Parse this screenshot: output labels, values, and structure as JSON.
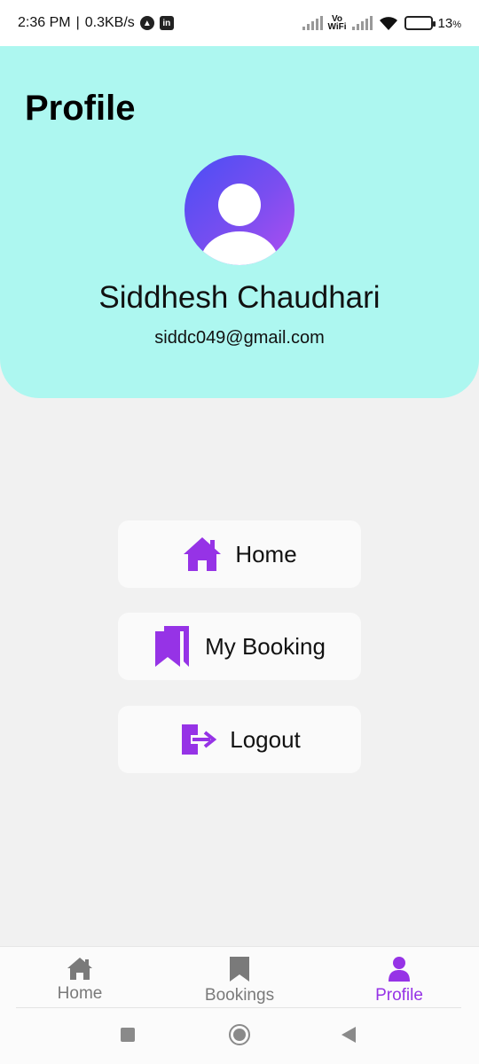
{
  "status_bar": {
    "time": "2:36 PM",
    "net_speed": "0.3KB/s",
    "separator": "|",
    "vowifi_top": "Vo",
    "vowifi_bottom": "WiFi",
    "battery_percent": "13",
    "battery_unit": "%"
  },
  "header": {
    "title": "Profile",
    "user_name": "Siddhesh Chaudhari",
    "user_email": "siddc049@gmail.com",
    "background_color": "#adf7f0",
    "avatar_gradient": [
      "#4a4ef5",
      "#b04ef0"
    ]
  },
  "menu": {
    "home_label": "Home",
    "booking_label": "My Booking",
    "logout_label": "Logout",
    "icon_color": "#9633e6"
  },
  "bottom_nav": {
    "items": [
      {
        "label": "Home",
        "icon": "home-icon",
        "active": false
      },
      {
        "label": "Bookings",
        "icon": "bookmark-icon",
        "active": false
      },
      {
        "label": "Profile",
        "icon": "person-icon",
        "active": true
      }
    ],
    "active_color": "#9633e6",
    "inactive_color": "#7a7a7a"
  }
}
